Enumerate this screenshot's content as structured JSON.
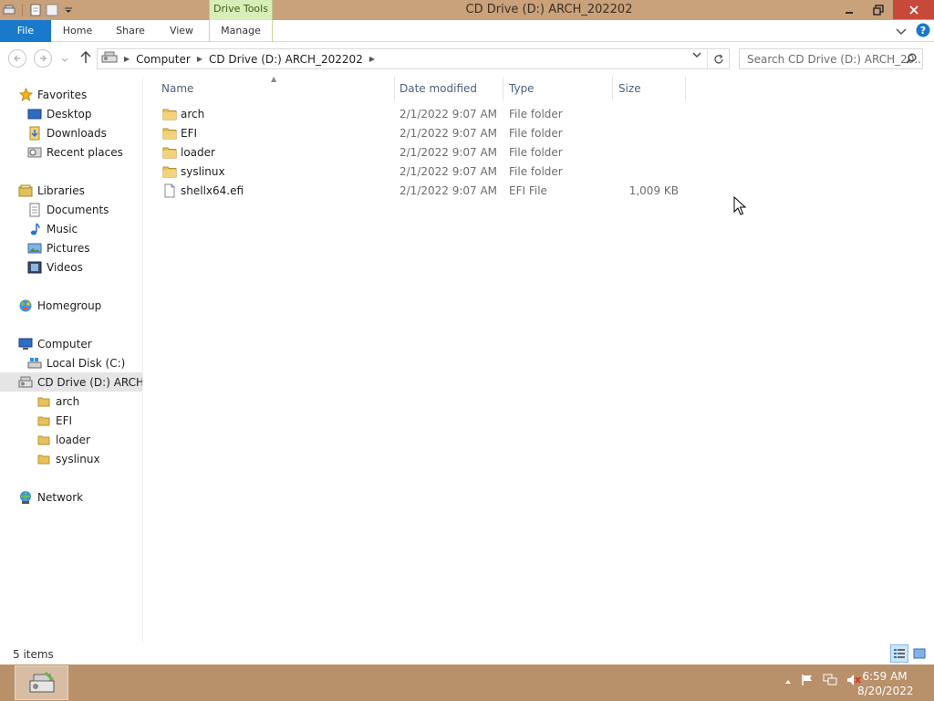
{
  "window": {
    "title": "CD Drive (D:) ARCH_202202",
    "context_tab_title": "Drive Tools"
  },
  "ribbon": {
    "tabs": [
      "File",
      "Home",
      "Share",
      "View",
      "Manage"
    ]
  },
  "address": {
    "crumbs": [
      "Computer",
      "CD Drive (D:) ARCH_202202"
    ],
    "search_placeholder": "Search CD Drive (D:) ARCH_20..."
  },
  "nav": {
    "favorites": "Favorites",
    "favorites_items": [
      "Desktop",
      "Downloads",
      "Recent places"
    ],
    "libraries": "Libraries",
    "libraries_items": [
      "Documents",
      "Music",
      "Pictures",
      "Videos"
    ],
    "homegroup": "Homegroup",
    "computer": "Computer",
    "computer_items": [
      "Local Disk (C:)",
      "CD Drive (D:) ARCH_"
    ],
    "cd_children": [
      "arch",
      "EFI",
      "loader",
      "syslinux"
    ],
    "network": "Network"
  },
  "columns": [
    "Name",
    "Date modified",
    "Type",
    "Size"
  ],
  "files": [
    {
      "name": "arch",
      "date": "2/1/2022 9:07 AM",
      "type": "File folder",
      "size": "",
      "icon": "folder-icon"
    },
    {
      "name": "EFI",
      "date": "2/1/2022 9:07 AM",
      "type": "File folder",
      "size": "",
      "icon": "folder-icon"
    },
    {
      "name": "loader",
      "date": "2/1/2022 9:07 AM",
      "type": "File folder",
      "size": "",
      "icon": "folder-icon"
    },
    {
      "name": "syslinux",
      "date": "2/1/2022 9:07 AM",
      "type": "File folder",
      "size": "",
      "icon": "folder-icon"
    },
    {
      "name": "shellx64.efi",
      "date": "2/1/2022 9:07 AM",
      "type": "EFI File",
      "size": "1,009 KB",
      "icon": "file-icon"
    }
  ],
  "status": {
    "item_count": "5 items"
  },
  "taskbar": {
    "time": "6:59 AM",
    "date": "8/20/2022"
  },
  "colors": {
    "titlebar": "#c9a17b",
    "file_tab": "#1979ca",
    "context_tab": "#d9edb9",
    "close_button": "#c7493a",
    "folder": "#e8c15a"
  }
}
